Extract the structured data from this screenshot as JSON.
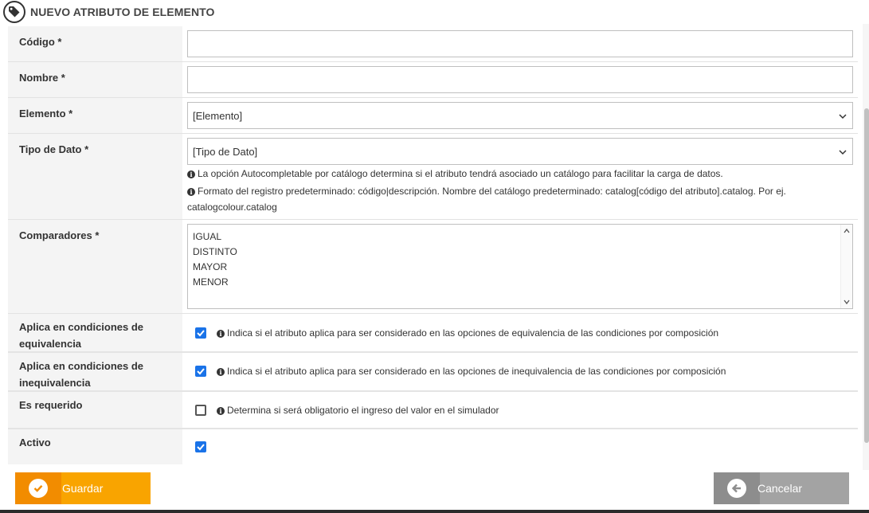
{
  "header": {
    "title": "NUEVO ATRIBUTO DE ELEMENTO",
    "icon": "tag-icon"
  },
  "fields": {
    "codigo": {
      "label": "Código *",
      "value": ""
    },
    "nombre": {
      "label": "Nombre *",
      "value": ""
    },
    "elemento": {
      "label": "Elemento *",
      "selected": "[Elemento]"
    },
    "tipo_dato": {
      "label": "Tipo de Dato *",
      "selected": "[Tipo de Dato]",
      "hint1": "La opción Autocompletable por catálogo determina si el atributo tendrá asociado un catálogo para facilitar la carga de datos.",
      "hint2": "Formato del registro predeterminado: código|descripción. Nombre del catálogo predeterminado: catalog[código del atributo].catalog. Por ej.",
      "hint3": "catalogcolour.catalog"
    },
    "comparadores": {
      "label": "Comparadores *",
      "options": [
        "IGUAL",
        "DISTINTO",
        "MAYOR",
        "MENOR"
      ]
    },
    "aplica_equivalencia": {
      "label_line1": "Aplica en condiciones de",
      "label_line2": "equivalencia",
      "checked": true,
      "hint": "Indica si el atributo aplica para ser considerado en las opciones de equivalencia de las condiciones por composición"
    },
    "aplica_inequivalencia": {
      "label_line1": "Aplica en condiciones de",
      "label_line2": "inequivalencia",
      "checked": true,
      "hint": "Indica si el atributo aplica para ser considerado en las opciones de inequivalencia de las condiciones por composición"
    },
    "es_requerido": {
      "label": "Es requerido",
      "checked": false,
      "hint": "Determina si será obligatorio el ingreso del valor en el simulador"
    },
    "activo": {
      "label": "Activo",
      "checked": true
    }
  },
  "buttons": {
    "save": "Guardar",
    "cancel": "Cancelar"
  },
  "colors": {
    "save": "#f9a400",
    "save_dark": "#f28c00",
    "cancel": "#a3a3a3",
    "checkbox": "#1a73e8"
  }
}
